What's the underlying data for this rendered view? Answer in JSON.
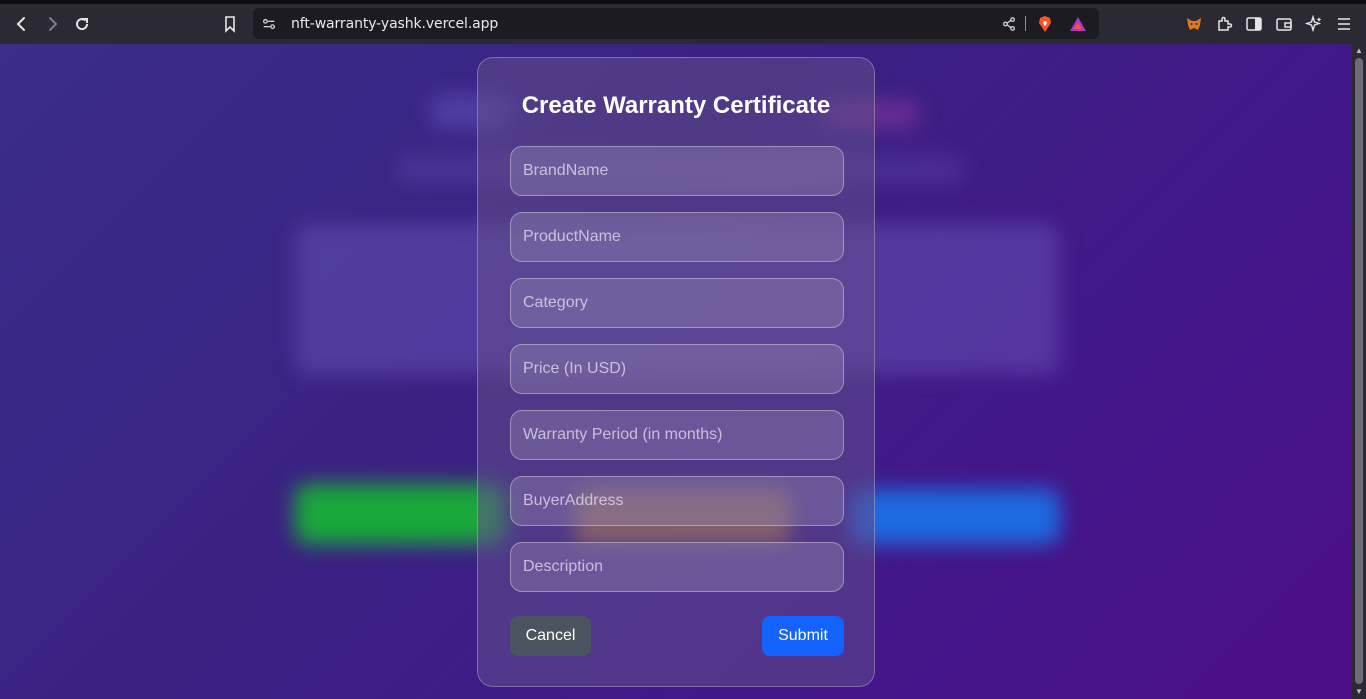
{
  "browser": {
    "url": "nft-warranty-yashk.vercel.app",
    "icons": [
      "back-icon",
      "forward-icon",
      "reload-icon",
      "bookmark-icon",
      "site-settings-icon",
      "share-icon",
      "brave-shields-icon",
      "brave-rewards-icon",
      "metamask-icon",
      "extensions-icon",
      "sidebar-icon",
      "wallet-icon",
      "leo-ai-icon",
      "menu-icon"
    ]
  },
  "modal": {
    "title": "Create Warranty Certificate",
    "fields": [
      {
        "placeholder": "BrandName",
        "value": ""
      },
      {
        "placeholder": "ProductName",
        "value": ""
      },
      {
        "placeholder": "Category",
        "value": ""
      },
      {
        "placeholder": "Price (In USD)",
        "value": ""
      },
      {
        "placeholder": "Warranty Period (in months)",
        "value": ""
      },
      {
        "placeholder": "BuyerAddress",
        "value": ""
      },
      {
        "placeholder": "Description",
        "value": ""
      }
    ],
    "cancel_label": "Cancel",
    "submit_label": "Submit"
  },
  "colors": {
    "background_start": "#3b2d8a",
    "background_end": "#4d0f86",
    "submit": "#1463ff",
    "cancel": "#4a5560"
  }
}
